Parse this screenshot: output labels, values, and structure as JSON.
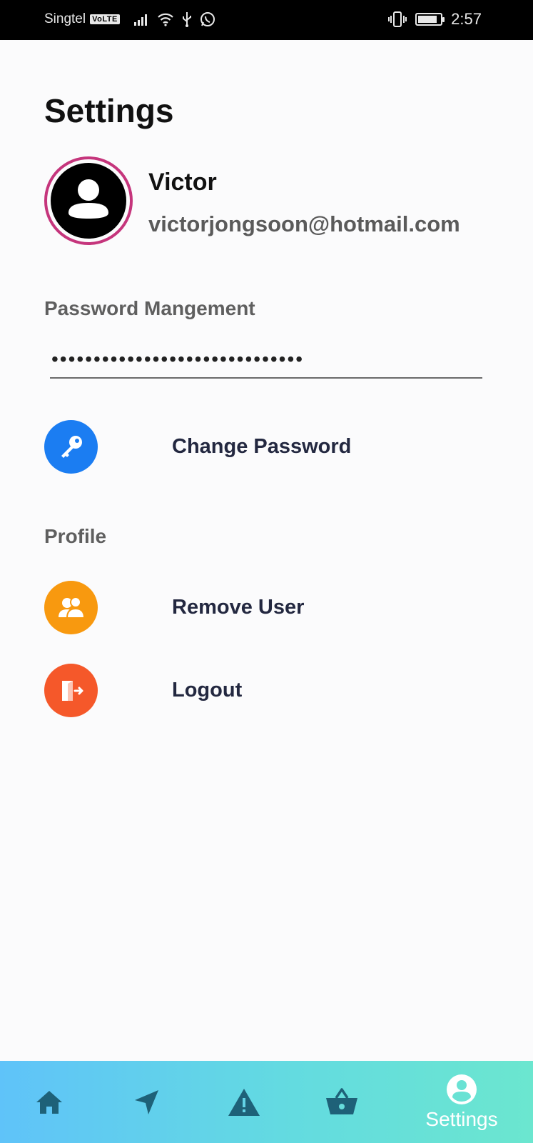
{
  "status_bar": {
    "carrier": "Singtel",
    "volte": "VoLTE",
    "time": "2:57",
    "battery_level": 0.85
  },
  "page": {
    "title": "Settings"
  },
  "profile": {
    "name": "Victor",
    "email": "victorjongsoon@hotmail.com",
    "avatar_ring_color": "#c5357c"
  },
  "password_section": {
    "label": "Password Mangement",
    "masked_value": "••••••••••••••••••••••••••••••",
    "change_password": {
      "label": "Change Password",
      "icon": "key-icon",
      "color": "#1b7df2"
    }
  },
  "profile_section": {
    "label": "Profile",
    "remove_user": {
      "label": "Remove User",
      "icon": "users-icon",
      "color": "#f8990f"
    },
    "logout": {
      "label": "Logout",
      "icon": "logout-icon",
      "color": "#f5582a"
    }
  },
  "bottom_nav": {
    "items": [
      {
        "icon": "home-icon",
        "label": ""
      },
      {
        "icon": "navigation-icon",
        "label": ""
      },
      {
        "icon": "warning-icon",
        "label": ""
      },
      {
        "icon": "basket-icon",
        "label": ""
      },
      {
        "icon": "account-icon",
        "label": "Settings",
        "active": true
      }
    ],
    "icon_color": "#1e6178",
    "active_color": "#ffffff"
  }
}
